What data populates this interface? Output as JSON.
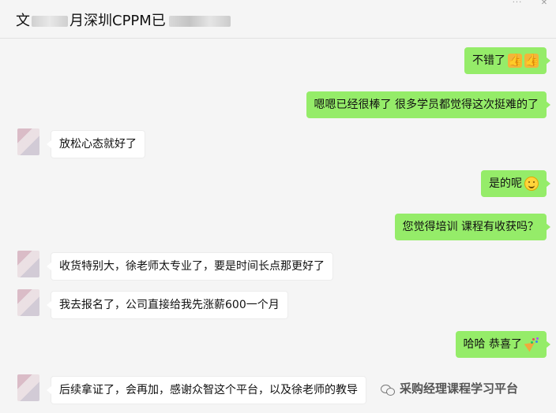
{
  "header": {
    "title_prefix": "文",
    "title_mid": "月深圳CPPM已",
    "more_icon": "more-icon",
    "close_icon": "close-icon"
  },
  "messages": [
    {
      "side": "me",
      "text": "不错了",
      "emoji": [
        "thumbs-up-icon",
        "thumbs-up-icon"
      ]
    },
    {
      "side": "me",
      "text": "嗯嗯已经很棒了 很多学员都觉得这次挺难的了"
    },
    {
      "side": "them",
      "text": "放松心态就好了"
    },
    {
      "side": "me",
      "text": "是的呢",
      "emoji": [
        "smile-icon"
      ]
    },
    {
      "side": "me",
      "text": "您觉得培训 课程有收获吗？"
    },
    {
      "side": "them",
      "text": "收货特别大，徐老师太专业了，要是时间长点那更好了"
    },
    {
      "side": "them",
      "text": "我去报名了，公司直接给我先涨薪600一个月"
    },
    {
      "side": "me",
      "text": "哈哈 恭喜了",
      "emoji": [
        "party-popper-icon"
      ]
    },
    {
      "side": "them",
      "text": "后续拿证了，会再加，感谢众智这个平台，以及徐老师的教导"
    }
  ],
  "watermark": {
    "text": "采购经理课程学习平台",
    "icon": "wechat-icon"
  },
  "colors": {
    "my_bubble": "#95ec69",
    "their_bubble": "#ffffff",
    "background": "#f5f5f5"
  }
}
